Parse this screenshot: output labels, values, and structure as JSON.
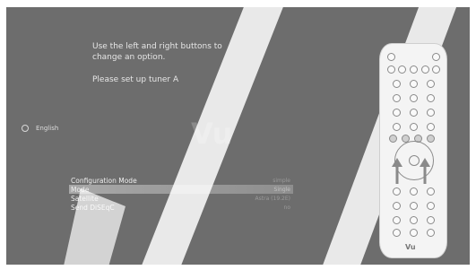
{
  "instructions": {
    "line1": "Use the left and right buttons to",
    "line2": "change an option.",
    "line3": "Please set up tuner A"
  },
  "language": {
    "label": "English"
  },
  "brand": {
    "logo_text": "Vu"
  },
  "settings": [
    {
      "label": "Configuration Mode",
      "value": "simple",
      "selected": false
    },
    {
      "label": "Mode",
      "value": "Single",
      "selected": true
    },
    {
      "label": "Satellite",
      "value": "Astra (19.2E)",
      "selected": false
    },
    {
      "label": "Send DiSEqC",
      "value": "no",
      "selected": false
    }
  ],
  "remote": {
    "logo_text": "Vu"
  },
  "colors": {
    "screen_bg": "#6d6d6d",
    "selected_row": "#a8a8a8",
    "watermark": "#ffffff"
  }
}
